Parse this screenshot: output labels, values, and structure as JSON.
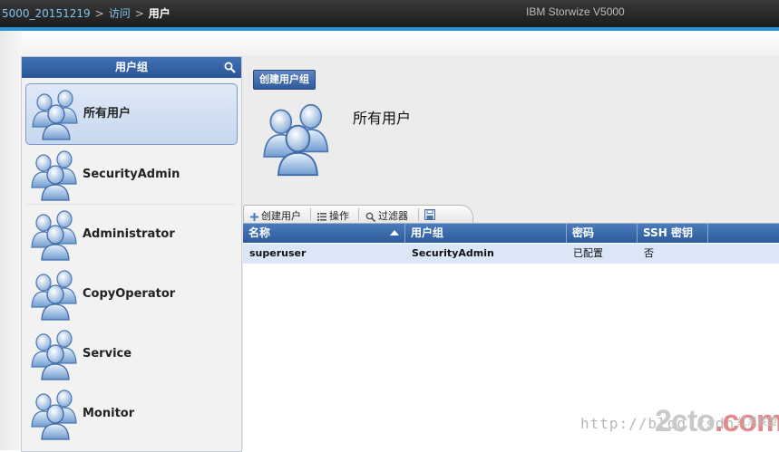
{
  "header": {
    "crumb_system": "5000_20151219",
    "crumb_access": "访问",
    "crumb_current": "用户",
    "separator": ">",
    "product": "IBM Storwize V5000"
  },
  "sidebar": {
    "title": "用户组",
    "items": [
      {
        "label": "所有用户",
        "selected": true
      },
      {
        "label": "SecurityAdmin"
      },
      {
        "label": "Administrator"
      },
      {
        "label": "CopyOperator"
      },
      {
        "label": "Service"
      },
      {
        "label": "Monitor"
      }
    ]
  },
  "main": {
    "create_group_button": "创建用户组",
    "group_title": "所有用户",
    "toolbar": {
      "create_user": "创建用户",
      "actions": "操作",
      "filter": "过滤器"
    },
    "table": {
      "columns": [
        "名称",
        "用户组",
        "密码",
        "SSH 密钥"
      ],
      "rows": [
        {
          "name": "superuser",
          "group": "SecurityAdmin",
          "password": "已配置",
          "ssh": "否"
        }
      ]
    }
  },
  "watermark": {
    "url": "http://blog.csdn",
    "brand": "2cto",
    "brand_tld": ".com",
    "brand_cn": "红黑联盟"
  },
  "colors": {
    "accent": "#2a8fd4",
    "header_blue": "#2c5a99",
    "row_selected": "#dbe7f7"
  }
}
